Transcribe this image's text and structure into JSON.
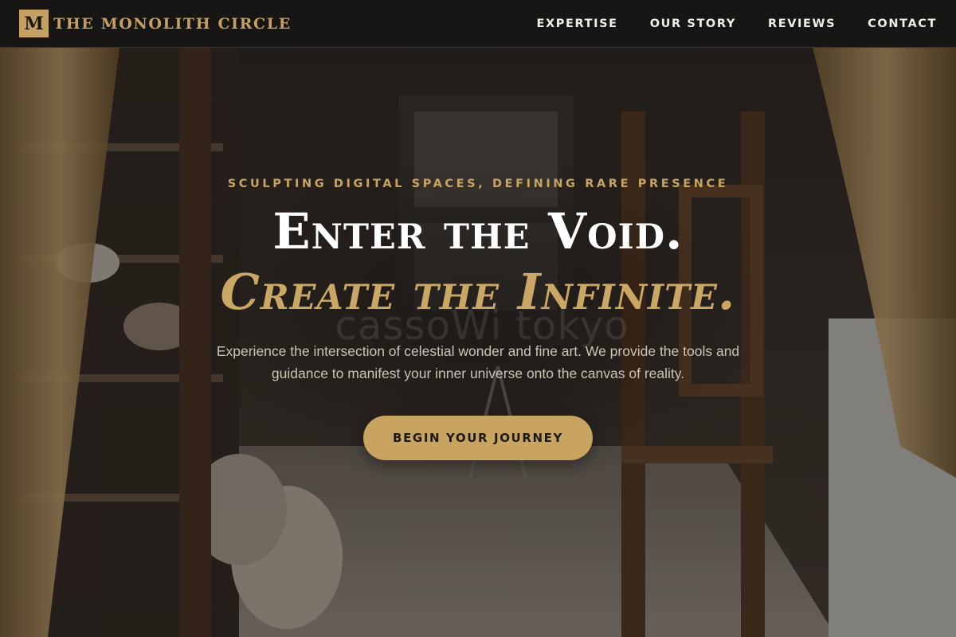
{
  "brand": {
    "logo_letter": "M",
    "name": "THE MONOLITH CIRCLE"
  },
  "nav": {
    "items": [
      {
        "label": "EXPERTISE"
      },
      {
        "label": "OUR STORY"
      },
      {
        "label": "REVIEWS"
      },
      {
        "label": "CONTACT"
      }
    ]
  },
  "hero": {
    "eyebrow": "SCULPTING DIGITAL SPACES, DEFINING RARE PRESENCE",
    "headline_line1": "Enter the Void.",
    "headline_line2": "Create the Infinite.",
    "subtext": "Experience the intersection of celestial wonder and fine art. We provide the tools and guidance to manifest your inner universe onto the canvas of reality.",
    "cta_label": "BEGIN YOUR JOURNEY",
    "watermark": "cassoWi tokyo",
    "background_icon": "art-studio-photo"
  },
  "colors": {
    "accent_gold": "#c9a461",
    "nav_background": "#181614",
    "nav_text": "#f2eee6",
    "headline_white": "#ffffff",
    "subtext": "#c9c3b8"
  }
}
